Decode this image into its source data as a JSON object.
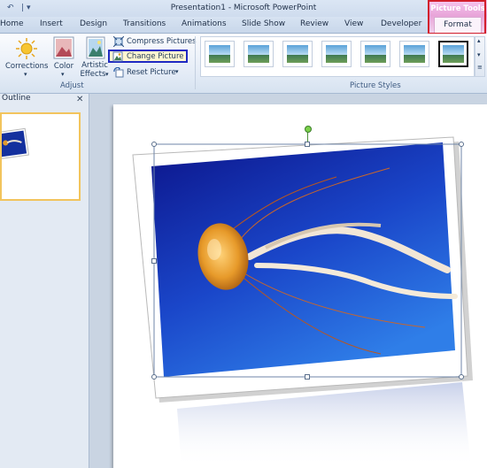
{
  "window": {
    "title": "Presentation1 - Microsoft PowerPoint"
  },
  "tabs": [
    "Home",
    "Insert",
    "Design",
    "Transitions",
    "Animations",
    "Slide Show",
    "Review",
    "View",
    "Developer"
  ],
  "contextual": {
    "group": "Picture Tools",
    "tab": "Format"
  },
  "ribbon": {
    "adjust": {
      "corrections": "Corrections",
      "color": "Color",
      "artistic_1": "Artistic",
      "artistic_2": "Effects",
      "compress": "Compress Pictures",
      "change": "Change Picture",
      "reset": "Reset Picture",
      "label": "Adjust"
    },
    "styles_label": "Picture Styles"
  },
  "pane": {
    "outline_tab": "Outline"
  }
}
